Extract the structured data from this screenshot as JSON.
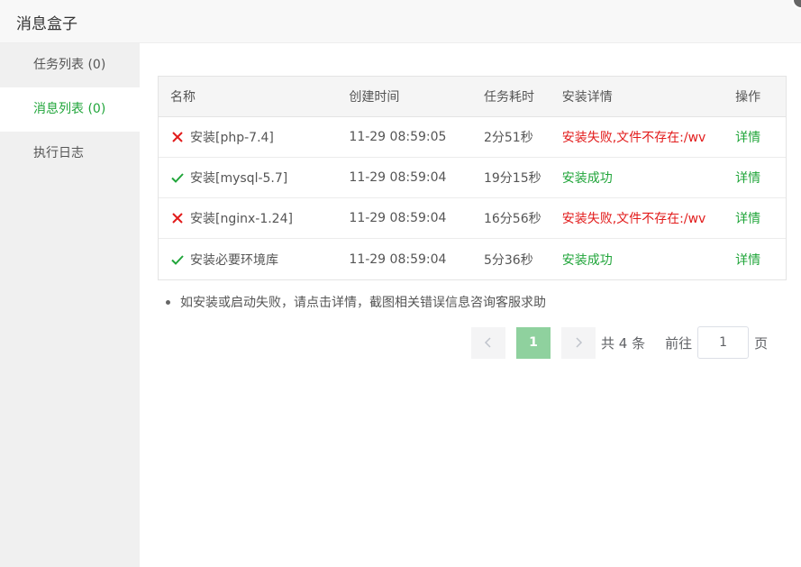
{
  "header": {
    "title": "消息盒子"
  },
  "sidebar": {
    "items": [
      {
        "label": "任务列表 (0)",
        "active": false
      },
      {
        "label": "消息列表 (0)",
        "active": true
      },
      {
        "label": "执行日志",
        "active": false
      }
    ]
  },
  "table": {
    "columns": [
      "名称",
      "创建时间",
      "任务耗时",
      "安装详情",
      "操作"
    ],
    "rows": [
      {
        "status": "fail",
        "status_icon": "x-icon",
        "name": "安装[php-7.4]",
        "created": "11-29 08:59:05",
        "duration": "2分51秒",
        "detail": "安装失败,文件不存在:/wv",
        "action": "详情"
      },
      {
        "status": "success",
        "status_icon": "check-icon",
        "name": "安装[mysql-5.7]",
        "created": "11-29 08:59:04",
        "duration": "19分15秒",
        "detail": "安装成功",
        "action": "详情"
      },
      {
        "status": "fail",
        "status_icon": "x-icon",
        "name": "安装[nginx-1.24]",
        "created": "11-29 08:59:04",
        "duration": "16分56秒",
        "detail": "安装失败,文件不存在:/wv",
        "action": "详情"
      },
      {
        "status": "success",
        "status_icon": "check-icon",
        "name": "安装必要环境库",
        "created": "11-29 08:59:04",
        "duration": "5分36秒",
        "detail": "安装成功",
        "action": "详情"
      }
    ]
  },
  "tip": "如安装或启动失败，请点击详情，截图相关错误信息咨询客服求助",
  "pagination": {
    "current_page": "1",
    "total_text": "共 4 条",
    "goto_label": "前往",
    "goto_value": "1",
    "page_suffix": "页"
  },
  "colors": {
    "accent": "#20a53a",
    "error": "#e21b1b",
    "active_page": "#8fd19e"
  }
}
